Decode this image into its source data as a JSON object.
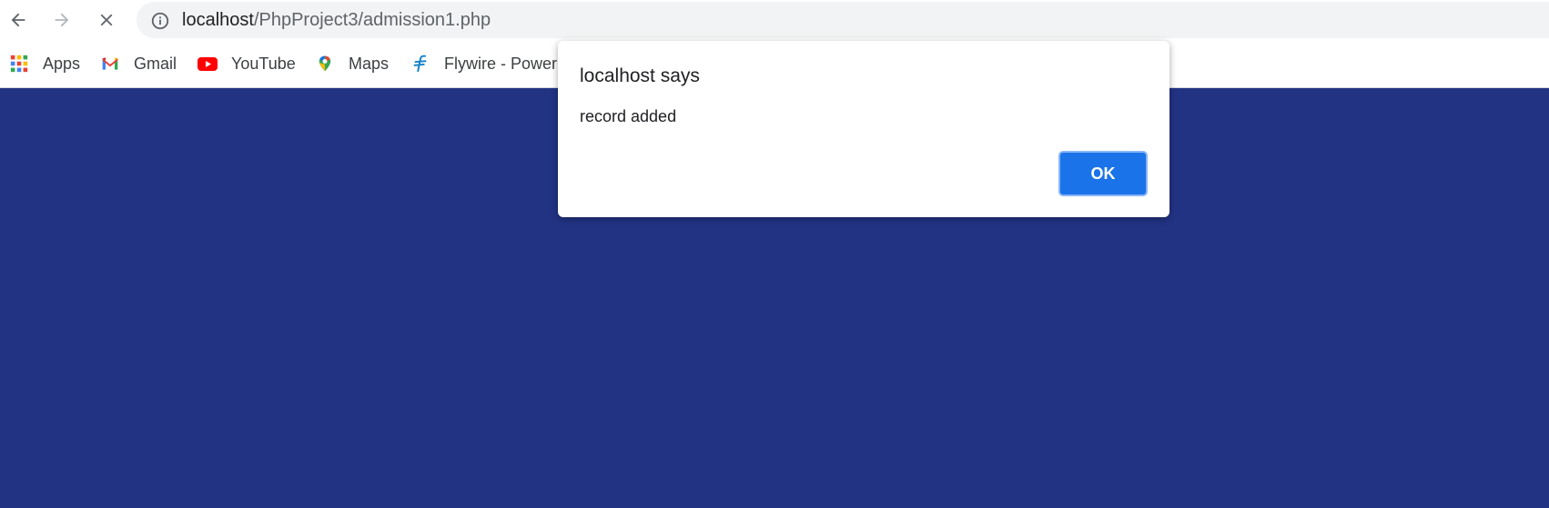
{
  "browser": {
    "url_host": "localhost",
    "url_path": "/PhpProject3/admission1.php",
    "bookmarks": [
      {
        "label": "Apps",
        "icon": "apps-grid-icon"
      },
      {
        "label": "Gmail",
        "icon": "gmail-icon"
      },
      {
        "label": "YouTube",
        "icon": "youtube-icon"
      },
      {
        "label": "Maps",
        "icon": "maps-pin-icon"
      },
      {
        "label": "Flywire - Poweri",
        "icon": "flywire-icon"
      }
    ]
  },
  "dialog": {
    "title": "localhost says",
    "message": "record added",
    "ok_label": "OK"
  },
  "colors": {
    "page_background": "#223384",
    "ok_button": "#1a73e8",
    "toolbar": "#ffffff",
    "omnibox": "#f1f3f4"
  }
}
